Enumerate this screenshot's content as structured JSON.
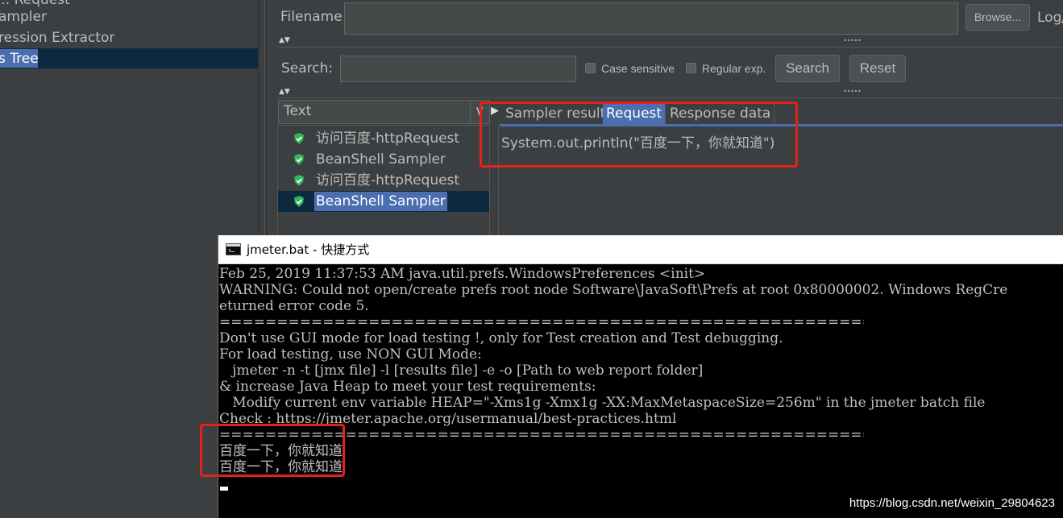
{
  "tree": {
    "items": [
      {
        "label": "... Request"
      },
      {
        "label": "ampler"
      },
      {
        "label": "ression Extractor"
      },
      {
        "label": "s Tree"
      }
    ]
  },
  "file_panel": {
    "filename_label": "Filename",
    "filename_value": "",
    "browse_label": "Browse...",
    "log_label": "Log/"
  },
  "search_panel": {
    "search_label": "Search:",
    "search_value": "",
    "case_sensitive_label": "Case sensitive",
    "regular_exp_label": "Regular exp.",
    "search_button": "Search",
    "reset_button": "Reset"
  },
  "results": {
    "renderer_label": "Text",
    "items": [
      {
        "label": "访问百度-httpRequest",
        "status": "success"
      },
      {
        "label": "BeanShell Sampler",
        "status": "success"
      },
      {
        "label": "访问百度-httpRequest",
        "status": "success"
      },
      {
        "label": "BeanShell Sampler",
        "status": "success",
        "selected": true
      }
    ]
  },
  "tabs": [
    {
      "label": "Sampler result"
    },
    {
      "label": "Request",
      "active": true
    },
    {
      "label": "Response data"
    }
  ],
  "request_content": "System.out.println(\"百度一下，你就知道\")",
  "console": {
    "title": "jmeter.bat - 快捷方式",
    "lines": [
      "Feb 25, 2019 11:37:53 AM java.util.prefs.WindowsPreferences <init>",
      "WARNING: Could not open/create prefs root node Software\\JavaSoft\\Prefs at root 0x80000002. Windows RegCre",
      "eturned error code 5.",
      "================================================================================",
      "Don't use GUI mode for load testing !, only for Test creation and Test debugging.",
      "For load testing, use NON GUI Mode:",
      "   jmeter -n -t [jmx file] -l [results file] -e -o [Path to web report folder]",
      "& increase Java Heap to meet your test requirements:",
      "   Modify current env variable HEAP=\"-Xms1g -Xmx1g -XX:MaxMetaspaceSize=256m\" in the jmeter batch file",
      "Check : https://jmeter.apache.org/usermanual/best-practices.html",
      "================================================================================",
      "百度一下，你就知道",
      "百度一下，你就知道"
    ]
  },
  "watermark": "https://blog.csdn.net/weixin_29804623",
  "colors": {
    "background": "#3c3f41",
    "selection": "#4b6eaf",
    "highlight_box": "#e3221b",
    "console_bg": "#000000"
  }
}
